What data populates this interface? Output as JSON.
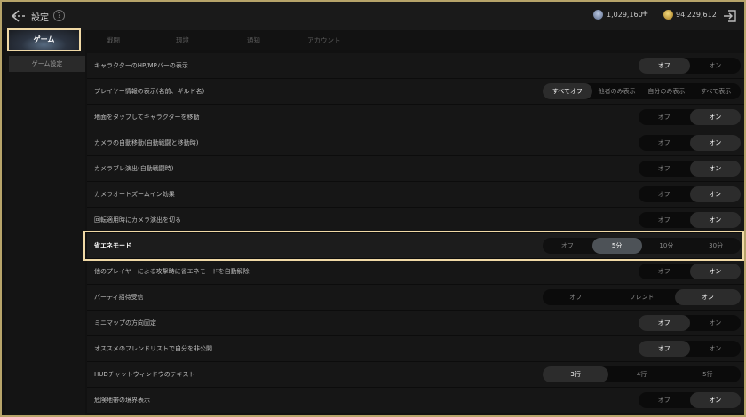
{
  "header": {
    "title": "設定",
    "help": "?",
    "resource1": "1,029,160",
    "resource1_plus": "+",
    "resource2": "94,229,612"
  },
  "sidebar": {
    "main": "ゲーム",
    "sub": "ゲーム設定"
  },
  "tabs": [
    "戦闘",
    "環境",
    "通知",
    "アカウント"
  ],
  "rows": [
    {
      "label": "キャラクターのHP/MPバーの表示",
      "options": [
        "オフ",
        "オン"
      ],
      "selected": 0
    },
    {
      "label": "プレイヤー情報の表示(名前、ギルド名)",
      "options": [
        "すべてオフ",
        "他者のみ表示",
        "自分のみ表示",
        "すべて表示"
      ],
      "selected": 0
    },
    {
      "label": "地面をタップしてキャラクターを移動",
      "options": [
        "オフ",
        "オン"
      ],
      "selected": 1
    },
    {
      "label": "カメラの自動移動(自動戦闘と移動時)",
      "options": [
        "オフ",
        "オン"
      ],
      "selected": 1
    },
    {
      "label": "カメラブレ演出(自動戦闘時)",
      "options": [
        "オフ",
        "オン"
      ],
      "selected": 1
    },
    {
      "label": "カメラオートズームイン効果",
      "options": [
        "オフ",
        "オン"
      ],
      "selected": 1
    },
    {
      "label": "回転適用時にカメラ演出を切る",
      "options": [
        "オフ",
        "オン"
      ],
      "selected": 1
    },
    {
      "label": "省エネモード",
      "options": [
        "オフ",
        "5分",
        "10分",
        "30分"
      ],
      "selected": 1
    },
    {
      "label": "他のプレイヤーによる攻撃時に省エネモードを自動解除",
      "options": [
        "オフ",
        "オン"
      ],
      "selected": 1
    },
    {
      "label": "パーティ招待受信",
      "options": [
        "オフ",
        "フレンド",
        "オン"
      ],
      "selected": 2
    },
    {
      "label": "ミニマップの方向固定",
      "options": [
        "オフ",
        "オン"
      ],
      "selected": 0
    },
    {
      "label": "オススメのフレンドリストで自分を非公開",
      "options": [
        "オフ",
        "オン"
      ],
      "selected": 0
    },
    {
      "label": "HUDチャットウィンドウのテキスト",
      "options": [
        "3行",
        "4行",
        "5行"
      ],
      "selected": 0
    },
    {
      "label": "危険地帯の境界表示",
      "options": [
        "オフ",
        "オン"
      ],
      "selected": 1
    }
  ],
  "colors": {
    "highlight_border": "#f0d9a6",
    "frame_border": "#b7a46a"
  }
}
